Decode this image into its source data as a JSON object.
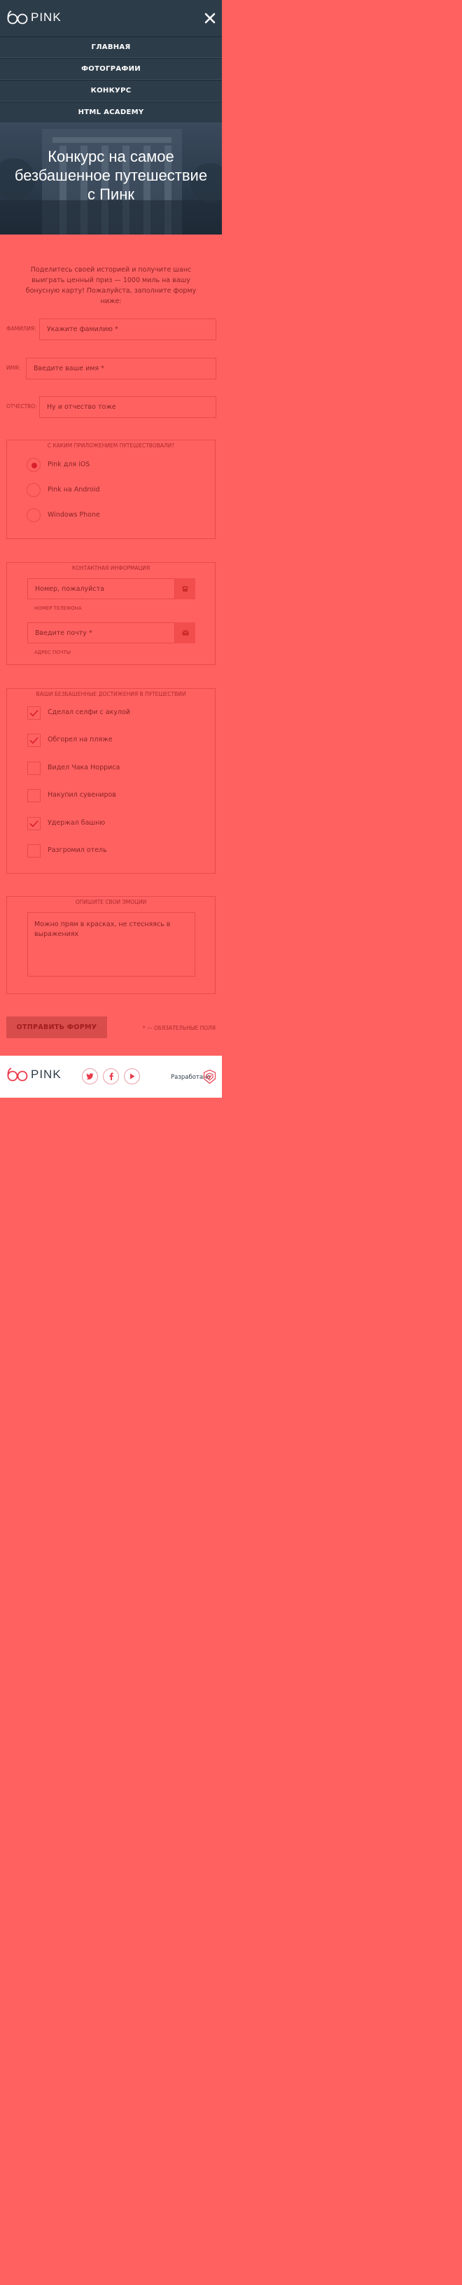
{
  "header": {
    "logo_text": "PINK",
    "nav_items": [
      {
        "label": "ГЛАВНАЯ"
      },
      {
        "label": "ФОТОГРАФИИ"
      },
      {
        "label": "КОНКУРС"
      },
      {
        "label": "HTML ACADEMY"
      }
    ]
  },
  "hero": {
    "title": "Конкурс на самое безбашенное путешествие с Пинк"
  },
  "intro": {
    "text": "Поделитесь своей историей и получите шанс выиграть ценный приз — 1000 миль на вашу бонусную карту! Пожалуйста, заполните форму ниже:"
  },
  "fields": {
    "surname": {
      "label": "ФАМИЛИЯ:",
      "placeholder": "Укажите фамилию *"
    },
    "name": {
      "label": "ИМЯ:",
      "placeholder": "Введите ваше имя *"
    },
    "patronymic": {
      "label": "ОТЧЕСТВО:",
      "placeholder": "Ну и отчество тоже"
    }
  },
  "app_group": {
    "legend": "С КАКИМ ПРИЛОЖЕНИЕМ ПУТЕШЕСТВОВАЛИ?",
    "options": [
      {
        "label": "Pink для iOS",
        "selected": true
      },
      {
        "label": "Pink на Android",
        "selected": false
      },
      {
        "label": "Windows Phone",
        "selected": false
      }
    ]
  },
  "contact_group": {
    "legend": "КОНТАКТНАЯ ИНФОРМАЦИЯ",
    "phone": {
      "placeholder": "Номер, пожалуйста",
      "hint": "НОМЕР ТЕЛЕФОНА",
      "icon": "phone-icon"
    },
    "email": {
      "placeholder": "Введите почту *",
      "hint": "АДРЕС ПОЧТЫ",
      "icon": "mail-icon"
    }
  },
  "achievements_group": {
    "legend": "ВАШИ БЕЗБАШЕННЫЕ ДОСТИЖЕНИЯ В ПУТЕШЕСТВИИ",
    "items": [
      {
        "label": "Сделал селфи с акулой",
        "checked": true
      },
      {
        "label": "Обгорел на пляже",
        "checked": true
      },
      {
        "label": "Видел Чака Норриса",
        "checked": false
      },
      {
        "label": "Накупил сувениров",
        "checked": false
      },
      {
        "label": "Удержал башню",
        "checked": true
      },
      {
        "label": "Разгромил отель",
        "checked": false
      }
    ]
  },
  "emotions_group": {
    "legend": "ОПИШИТЕ СВОИ ЭМОЦИИ",
    "placeholder": "Можно прям в красках, не стесняясь в выражениях"
  },
  "submit": {
    "label": "ОТПРАВИТЬ ФОРМУ"
  },
  "required_note": "* — ОБЯЗАТЕЛЬНЫЕ ПОЛЯ",
  "footer": {
    "logo_text": "PINK",
    "social": [
      "twitter-icon",
      "facebook-icon",
      "youtube-icon"
    ],
    "developer_label": "Разработано"
  },
  "colors": {
    "header_bg": "#2d3c49",
    "page_bg": "#ff6161",
    "accent": "#d91f2b",
    "border": "#e84848",
    "footer_bg": "#ffffff"
  }
}
